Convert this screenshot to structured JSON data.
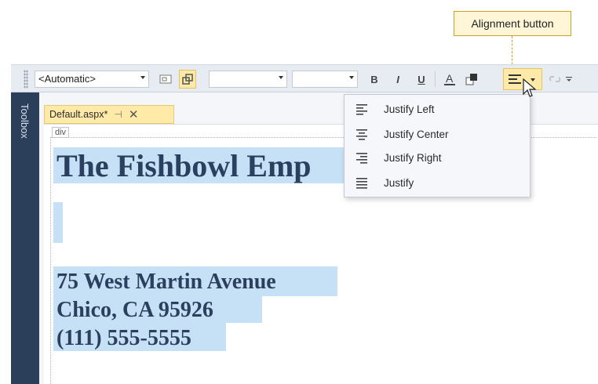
{
  "callout": {
    "text": "Alignment button"
  },
  "toolbar": {
    "block_format": "<Automatic>",
    "font_name": "",
    "font_size": "",
    "bold": "B",
    "italic": "I",
    "underline": "U",
    "icons": [
      "design-mode-icon",
      "position-icon",
      "bold-icon",
      "italic-icon",
      "underline-icon",
      "foreground-color-icon",
      "background-color-icon",
      "align-left-icon",
      "hyperlink-icon",
      "overflow-icon"
    ]
  },
  "toolbox": {
    "label": "Toolbox"
  },
  "tab": {
    "title": "Default.aspx*",
    "pin": "⊣",
    "close": "✕"
  },
  "document": {
    "tag_badge": "div",
    "heading": "The Fishbowl Emp",
    "address_lines": [
      "75 West Martin Avenue",
      "Chico, CA 95926",
      "(111) 555-5555"
    ]
  },
  "alignment_menu": {
    "items": [
      {
        "label": "Justify Left",
        "icon": "align-left-icon"
      },
      {
        "label": "Justify Center",
        "icon": "align-center-icon"
      },
      {
        "label": "Justify Right",
        "icon": "align-right-icon"
      },
      {
        "label": "Justify",
        "icon": "align-justify-icon"
      }
    ]
  },
  "colors": {
    "selection": "#c6e0f5",
    "text": "#2b3f5f",
    "sidebar": "#2b3f5a",
    "callout_border": "#c9a227",
    "tab_bg": "#ffeaa7"
  }
}
